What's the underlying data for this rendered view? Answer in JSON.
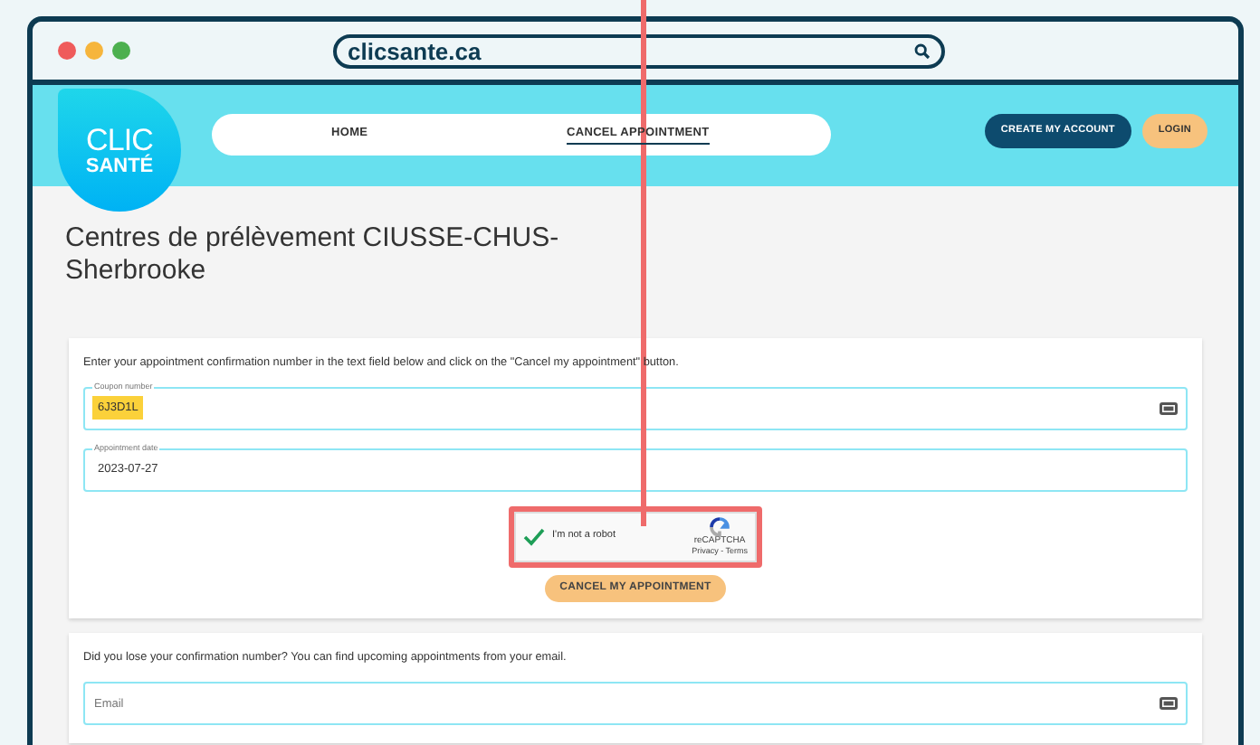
{
  "browser": {
    "url": "clicsante.ca"
  },
  "header": {
    "logo": [
      "CLIC",
      "SANTÉ"
    ],
    "nav": [
      {
        "label": "HOME",
        "selected": false
      },
      {
        "label": "CANCEL APPOINTMENT",
        "selected": true
      }
    ],
    "buttons": [
      {
        "label": "CREATE MY ACCOUNT",
        "kind": "primary"
      },
      {
        "label": "LOGIN",
        "kind": "secondary"
      }
    ]
  },
  "heading": "Centres de prélèvement CIUSSE-CHUS-Sherbrooke",
  "cancel_form": {
    "instructions": "Enter your appointment confirmation number in the text field below and click on the \"Cancel my appointment\" button.",
    "fields": [
      {
        "label": "Coupon number",
        "value": "6J3D1L",
        "highlighted": true,
        "icon": true
      },
      {
        "label": "Appointment date",
        "value": "2023-07-27",
        "highlighted": false,
        "icon": false
      }
    ],
    "captcha": {
      "label": "I'm not a robot",
      "checked": true,
      "brand": "reCAPTCHA",
      "links": "Privacy - Terms",
      "highlighted": true
    },
    "submit": "CANCEL MY APPOINTMENT"
  },
  "lookup_form": {
    "instructions": "Did you lose your confirmation number? You can find upcoming appointments from your email.",
    "field": {
      "placeholder": "Email"
    }
  }
}
